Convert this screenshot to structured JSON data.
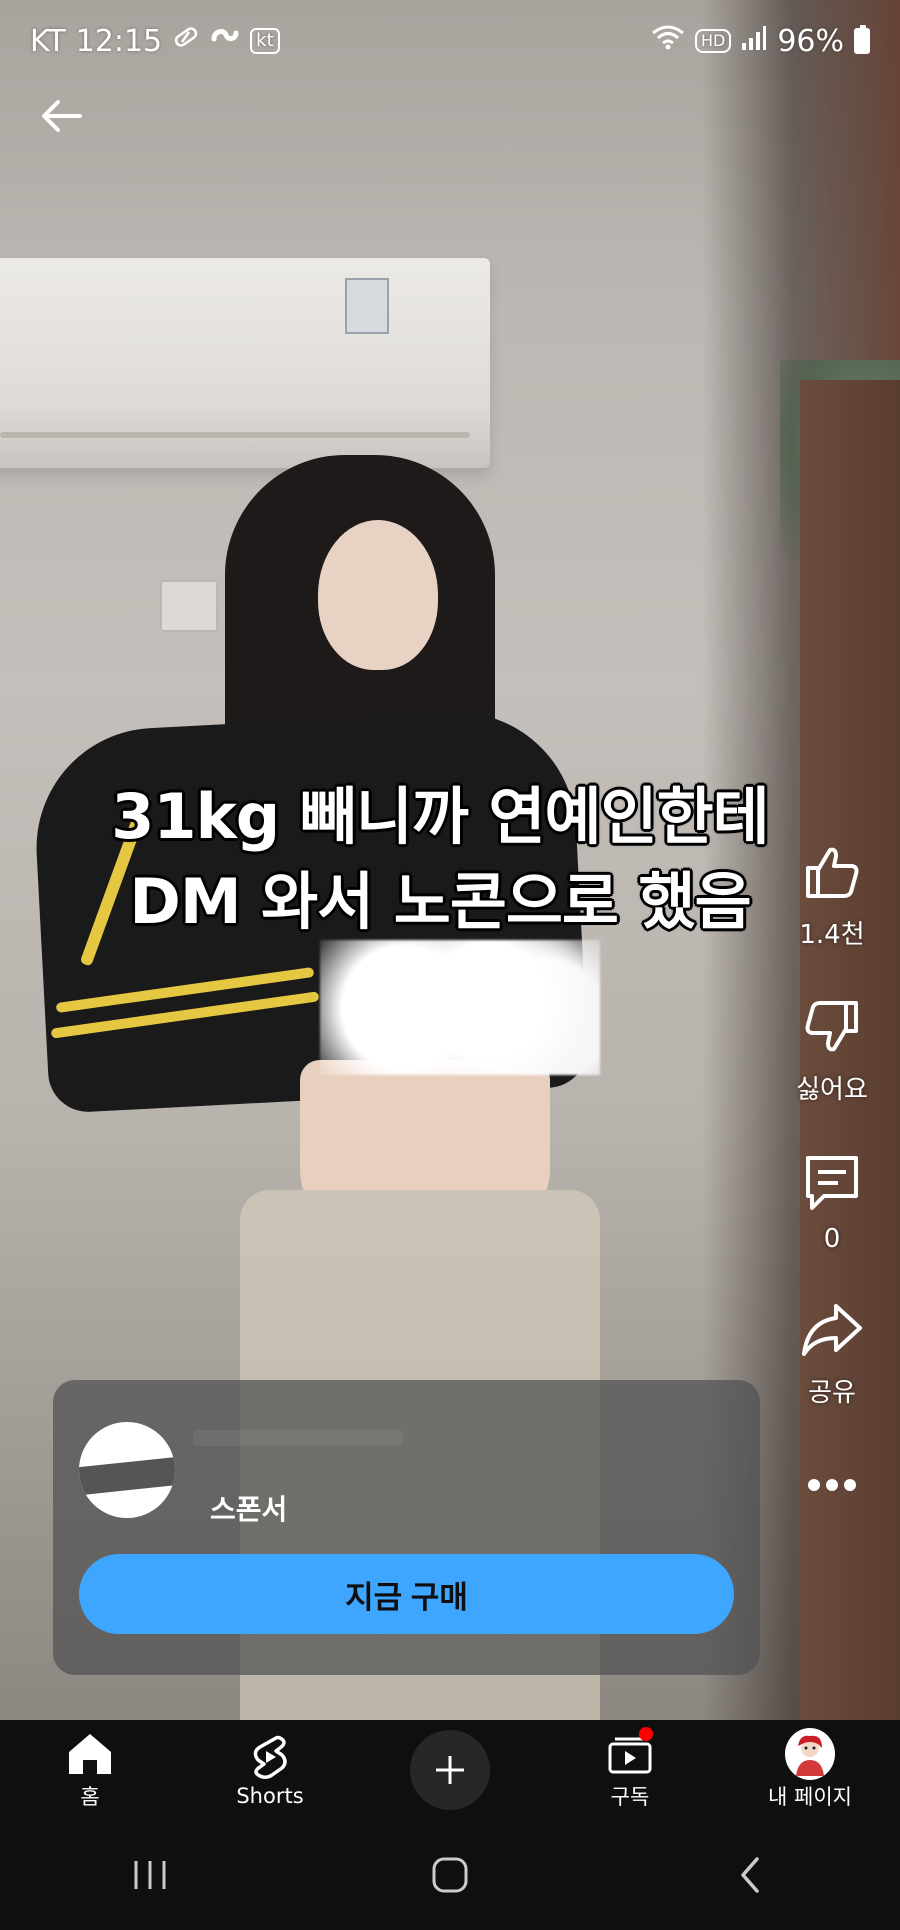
{
  "status_bar": {
    "carrier": "KT",
    "time": "12:15",
    "kt_badge": "kt",
    "hd_badge": "HD",
    "battery": "96%"
  },
  "caption": {
    "line1": "31kg 빼니까 연예인한테",
    "line2": "DM 와서 노콘으로 했음"
  },
  "actions": {
    "like_count": "1.4천",
    "dislike_label": "싫어요",
    "comment_count": "0",
    "share_label": "공유"
  },
  "sponsor_card": {
    "sponsor_label": "스폰서",
    "cta_label": "지금 구매"
  },
  "bottom_nav": {
    "home": "홈",
    "shorts": "Shorts",
    "subscriptions": "구독",
    "my_page": "내 페이지"
  },
  "colors": {
    "cta_blue": "#3ea6ff",
    "notification_red": "#ff0000",
    "nav_bg": "#0f0f0f"
  },
  "icons": [
    "back-arrow-icon",
    "like-icon",
    "dislike-icon",
    "comment-icon",
    "share-icon",
    "more-icon",
    "home-icon",
    "shorts-icon",
    "create-icon",
    "subscriptions-icon",
    "profile-avatar"
  ]
}
